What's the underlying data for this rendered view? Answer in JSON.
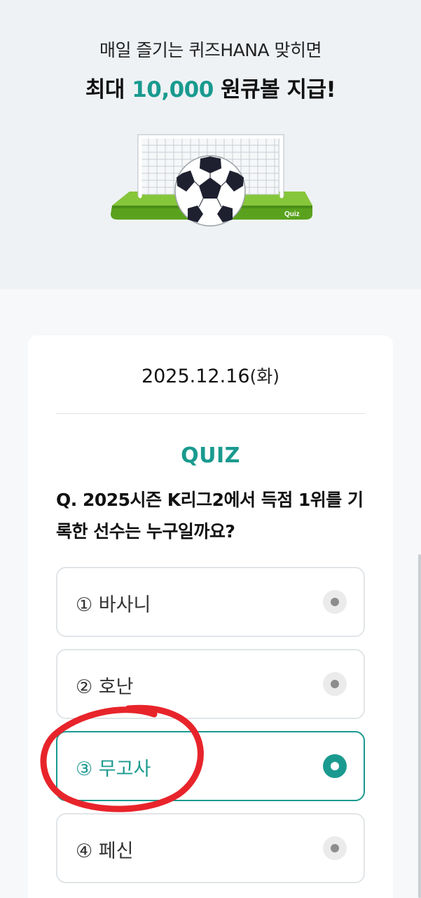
{
  "hero": {
    "line1": "매일 즐기는 퀴즈HANA 맞히면",
    "line2_prefix": "최대 ",
    "line2_accent": "10,000",
    "line2_suffix": " 원큐볼 지급!",
    "illustration": "soccer-goal-with-ball",
    "illustration_label": "Quiz"
  },
  "quiz": {
    "date": "2025.12.16",
    "weekday": "(화)",
    "label": "QUIZ",
    "question": "Q. 2025시즌 K리그2에서 득점 1위를 기록한 선수는 누구일까요?",
    "options": [
      {
        "label": "① 바사니",
        "selected": false
      },
      {
        "label": "② 호난",
        "selected": false
      },
      {
        "label": "③ 무고사",
        "selected": true
      },
      {
        "label": "④ 페신",
        "selected": false
      }
    ]
  },
  "colors": {
    "accent": "#1a9a8f",
    "hero_bg": "#eef2f5",
    "annotation_red": "#e8242b"
  }
}
